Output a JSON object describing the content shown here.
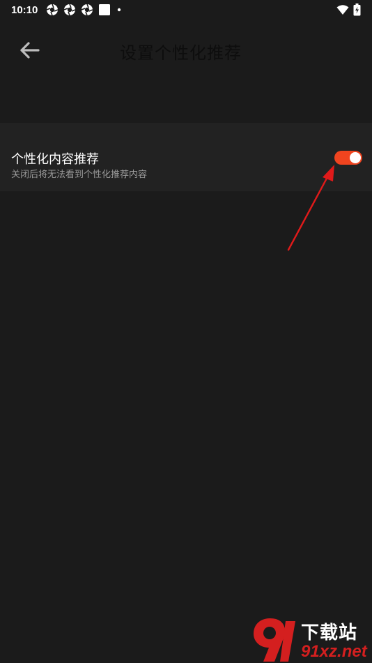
{
  "status_bar": {
    "time": "10:10",
    "left_icons": [
      "aperture-icon",
      "aperture-icon",
      "aperture-icon",
      "square-icon",
      "dot-icon"
    ],
    "right_icons": [
      "wifi-icon",
      "battery-charging-icon"
    ]
  },
  "header": {
    "title": "设置个性化推荐",
    "back_icon": "arrow-left-icon"
  },
  "setting": {
    "title": "个性化内容推荐",
    "subtitle": "关闭后将无法看到个性化推荐内容",
    "enabled": true
  },
  "watermark": {
    "title": "下载站",
    "url": "91xz.net",
    "logo_icon": "91-logo-icon"
  },
  "colors": {
    "background": "#1b1b1b",
    "row_background": "#222222",
    "accent": "#f0441f",
    "annotation": "#e01a1a"
  }
}
